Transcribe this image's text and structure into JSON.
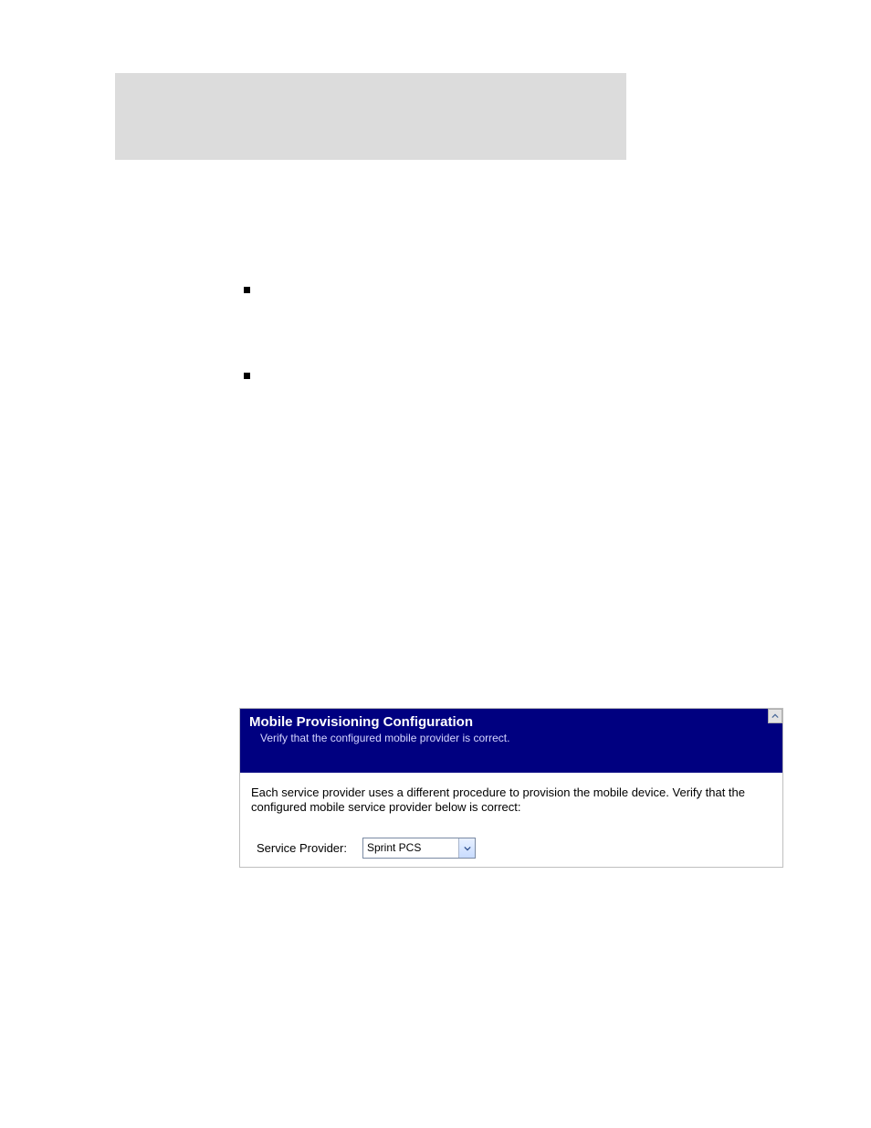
{
  "dialog": {
    "title": "Mobile Provisioning Configuration",
    "subtitle": "Verify that the configured mobile provider is correct.",
    "body_text": "Each service provider uses a different procedure to provision the mobile device. Verify that the configured mobile service provider below is correct:",
    "sp_label": "Service Provider:",
    "sp_value": "Sprint PCS"
  }
}
